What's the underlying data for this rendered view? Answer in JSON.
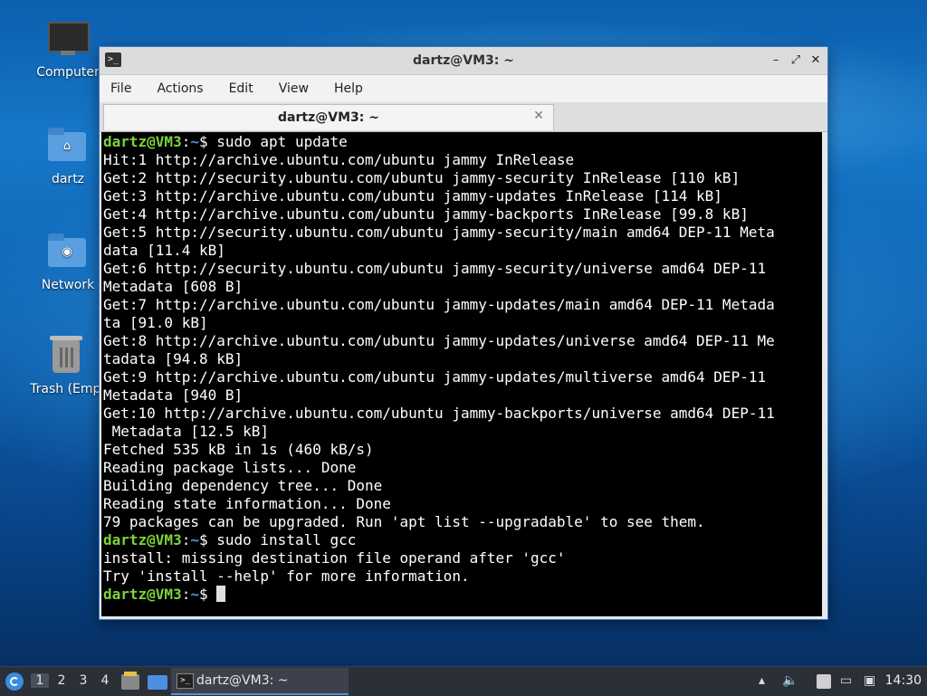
{
  "desktop": {
    "icons": [
      {
        "label": "Computer"
      },
      {
        "label": "dartz"
      },
      {
        "label": "Network"
      },
      {
        "label": "Trash (Empt"
      }
    ]
  },
  "window": {
    "title": "dartz@VM3: ~",
    "app_icon": ">_",
    "buttons": {
      "minimize": "–",
      "maximize": "⤢",
      "close": "✕"
    },
    "menu": [
      "File",
      "Actions",
      "Edit",
      "View",
      "Help"
    ],
    "tab": {
      "label": "dartz@VM3: ~",
      "close": "✕"
    }
  },
  "terminal": {
    "user": "dartz@VM3",
    "path": "~",
    "lines": [
      {
        "prompt": true,
        "cmd": "sudo apt update"
      },
      {
        "text": "Hit:1 http://archive.ubuntu.com/ubuntu jammy InRelease"
      },
      {
        "text": "Get:2 http://security.ubuntu.com/ubuntu jammy-security InRelease [110 kB]"
      },
      {
        "text": "Get:3 http://archive.ubuntu.com/ubuntu jammy-updates InRelease [114 kB]"
      },
      {
        "text": "Get:4 http://archive.ubuntu.com/ubuntu jammy-backports InRelease [99.8 kB]"
      },
      {
        "text": "Get:5 http://security.ubuntu.com/ubuntu jammy-security/main amd64 DEP-11 Meta"
      },
      {
        "text": "data [11.4 kB]"
      },
      {
        "text": "Get:6 http://security.ubuntu.com/ubuntu jammy-security/universe amd64 DEP-11"
      },
      {
        "text": "Metadata [608 B]"
      },
      {
        "text": "Get:7 http://archive.ubuntu.com/ubuntu jammy-updates/main amd64 DEP-11 Metada"
      },
      {
        "text": "ta [91.0 kB]"
      },
      {
        "text": "Get:8 http://archive.ubuntu.com/ubuntu jammy-updates/universe amd64 DEP-11 Me"
      },
      {
        "text": "tadata [94.8 kB]"
      },
      {
        "text": "Get:9 http://archive.ubuntu.com/ubuntu jammy-updates/multiverse amd64 DEP-11"
      },
      {
        "text": "Metadata [940 B]"
      },
      {
        "text": "Get:10 http://archive.ubuntu.com/ubuntu jammy-backports/universe amd64 DEP-11"
      },
      {
        "text": " Metadata [12.5 kB]"
      },
      {
        "text": "Fetched 535 kB in 1s (460 kB/s)"
      },
      {
        "text": "Reading package lists... Done"
      },
      {
        "text": "Building dependency tree... Done"
      },
      {
        "text": "Reading state information... Done"
      },
      {
        "text": "79 packages can be upgraded. Run 'apt list --upgradable' to see them."
      },
      {
        "prompt": true,
        "cmd": "sudo install gcc"
      },
      {
        "text": "install: missing destination file operand after 'gcc'"
      },
      {
        "text": "Try 'install --help' for more information."
      },
      {
        "prompt": true,
        "cmd": "",
        "cursor": true
      }
    ]
  },
  "taskbar": {
    "workspaces": [
      "1",
      "2",
      "3",
      "4"
    ],
    "active_workspace": "1",
    "task_label": "dartz@VM3: ~",
    "task_icon": ">_",
    "clock": "14:30",
    "colors": {
      "bar": "#2b2f38",
      "accent": "#5b8fd6"
    }
  }
}
